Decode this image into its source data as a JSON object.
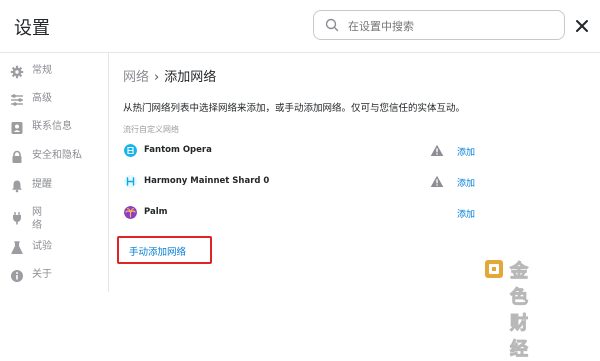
{
  "header": {
    "title": "设置",
    "search_placeholder": "在设置中搜索"
  },
  "sidebar": {
    "items": [
      {
        "label": "常规",
        "icon": "gear-icon"
      },
      {
        "label": "高级",
        "icon": "sliders-icon"
      },
      {
        "label": "联系信息",
        "icon": "contact-card-icon"
      },
      {
        "label": "安全和隐私",
        "icon": "lock-icon"
      },
      {
        "label": "提醒",
        "icon": "bell-icon"
      },
      {
        "label": "网络",
        "icon": "plug-icon"
      },
      {
        "label": "试验",
        "icon": "flask-icon"
      },
      {
        "label": "关于",
        "icon": "info-icon"
      }
    ]
  },
  "main": {
    "breadcrumb_parent": "网络",
    "breadcrumb_separator": "›",
    "breadcrumb_current": "添加网络",
    "description": "从热门网络列表中选择网络来添加，或手动添加网络。仅可与您信任的实体互动。",
    "section_title": "流行自定义网络",
    "networks": [
      {
        "name": "Fantom Opera",
        "action": "添加",
        "warning": true
      },
      {
        "name": "Harmony Mainnet Shard 0",
        "action": "添加",
        "warning": true
      },
      {
        "name": "Palm",
        "action": "添加",
        "warning": false
      }
    ],
    "manual_link": "手动添加网络"
  },
  "watermark": {
    "text": "金色财经"
  },
  "colors": {
    "link": "#037dd6",
    "highlight_box": "#e02424",
    "muted": "#8b8d92"
  }
}
